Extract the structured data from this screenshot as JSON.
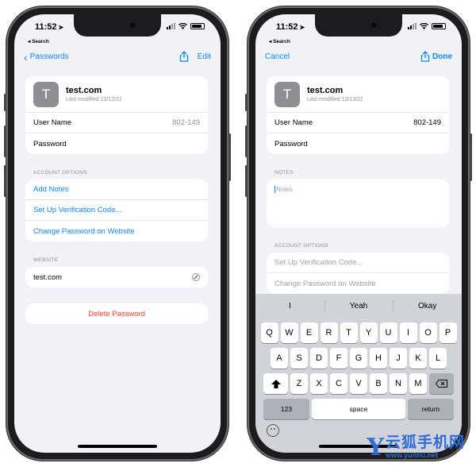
{
  "left_phone": {
    "status": {
      "time": "11:52",
      "back_label": "◂ Search"
    },
    "nav": {
      "back_label": "Passwords",
      "right_label": "Edit"
    },
    "site": {
      "initial": "T",
      "name": "test.com",
      "modified": "Last modified 12/12/21"
    },
    "fields": [
      {
        "label": "User Name",
        "value": "802-149"
      },
      {
        "label": "Password",
        "value": ""
      }
    ],
    "account_options_header": "ACCOUNT OPTIONS",
    "account_options": [
      "Add Notes",
      "Set Up Verification Code...",
      "Change Password on Website"
    ],
    "website_header": "WEBSITE",
    "website": "test.com",
    "delete_label": "Delete Password"
  },
  "right_phone": {
    "status": {
      "time": "11:52",
      "back_label": "◂ Search"
    },
    "nav": {
      "left_label": "Cancel",
      "right_label": "Done"
    },
    "site": {
      "initial": "T",
      "name": "test.com",
      "modified": "Last modified 12/13/21"
    },
    "fields": [
      {
        "label": "User Name",
        "value": "802-149"
      },
      {
        "label": "Password",
        "value": ""
      }
    ],
    "notes_header": "NOTES",
    "notes_placeholder": "Notes",
    "account_options_header": "ACCOUNT OPTIONS",
    "account_options": [
      "Set Up Verification Code...",
      "Change Password on Website"
    ],
    "keyboard": {
      "suggestions": [
        "I",
        "Yeah",
        "Okay"
      ],
      "row1": [
        "Q",
        "W",
        "E",
        "R",
        "T",
        "Y",
        "U",
        "I",
        "O",
        "P"
      ],
      "row2": [
        "A",
        "S",
        "D",
        "F",
        "G",
        "H",
        "J",
        "K",
        "L"
      ],
      "row3": [
        "Z",
        "X",
        "C",
        "V",
        "B",
        "N",
        "M"
      ],
      "numbers_label": "123",
      "space_label": "space",
      "return_label": "return"
    }
  },
  "watermark": {
    "logo_letter": "Y",
    "brand": "云狐手机网",
    "url": "www.yunhu.net"
  },
  "colors": {
    "accent": "#0a84ff",
    "destructive": "#ff3b30",
    "background": "#f2f2f7",
    "keyboard": "#d1d3d9",
    "watermark": "#2e6dd8"
  }
}
